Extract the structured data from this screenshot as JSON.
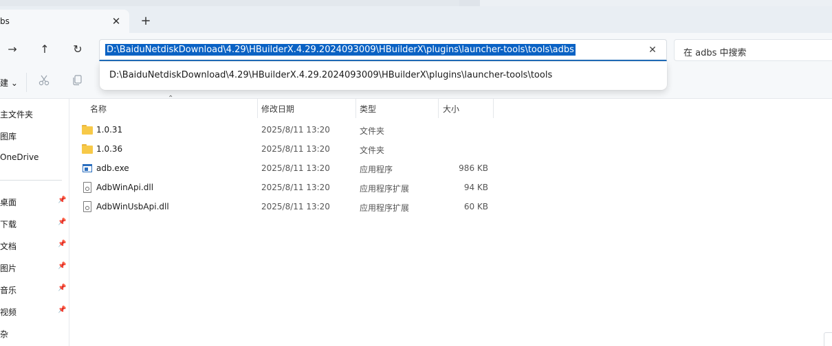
{
  "tab": {
    "title": "bs",
    "close_glyph": "✕",
    "new_glyph": "+"
  },
  "nav": {
    "forward_glyph": "→",
    "up_glyph": "↑",
    "refresh_glyph": "↻"
  },
  "address": {
    "value": "D:\\BaiduNetdiskDownload\\4.29\\HBuilderX.4.29.2024093009\\HBuilderX\\plugins\\launcher-tools\\tools\\adbs",
    "clear_glyph": "✕"
  },
  "search": {
    "placeholder": "在 adbs 中搜索"
  },
  "suggestions": [
    "D:\\BaiduNetdiskDownload\\4.29\\HBuilderX.4.29.2024093009\\HBuilderX\\plugins\\launcher-tools\\tools"
  ],
  "toolbar": {
    "new_label": "建",
    "new_chevron": "⌄",
    "cut_icon": "scissors-icon",
    "copy_icon": "copy-icon"
  },
  "sidebar": {
    "items": [
      {
        "label": "主文件夹",
        "pinned": false
      },
      {
        "label": "图库",
        "pinned": false
      },
      {
        "label": "OneDrive",
        "pinned": false
      },
      {
        "label": "桌面",
        "pinned": true
      },
      {
        "label": "下载",
        "pinned": true
      },
      {
        "label": "文档",
        "pinned": true
      },
      {
        "label": "图片",
        "pinned": true
      },
      {
        "label": "音乐",
        "pinned": true
      },
      {
        "label": "视频",
        "pinned": true
      },
      {
        "label": "杂",
        "pinned": false
      }
    ],
    "pin_glyph": "📌"
  },
  "columns": {
    "name": "名称",
    "modified": "修改日期",
    "type": "类型",
    "size": "大小",
    "sort_glyph": "⌃"
  },
  "files": [
    {
      "name": "1.0.31",
      "modified": "2025/8/11 13:20",
      "type": "文件夹",
      "size": "",
      "icon": "folder-icon"
    },
    {
      "name": "1.0.36",
      "modified": "2025/8/11 13:20",
      "type": "文件夹",
      "size": "",
      "icon": "folder-icon"
    },
    {
      "name": "adb.exe",
      "modified": "2025/8/11 13:20",
      "type": "应用程序",
      "size": "986 KB",
      "icon": "application-icon"
    },
    {
      "name": "AdbWinApi.dll",
      "modified": "2025/8/11 13:20",
      "type": "应用程序扩展",
      "size": "94 KB",
      "icon": "dll-file-icon"
    },
    {
      "name": "AdbWinUsbApi.dll",
      "modified": "2025/8/11 13:20",
      "type": "应用程序扩展",
      "size": "60 KB",
      "icon": "dll-file-icon"
    }
  ],
  "colors": {
    "accent": "#0a62c4",
    "folder": "#f7c948"
  }
}
